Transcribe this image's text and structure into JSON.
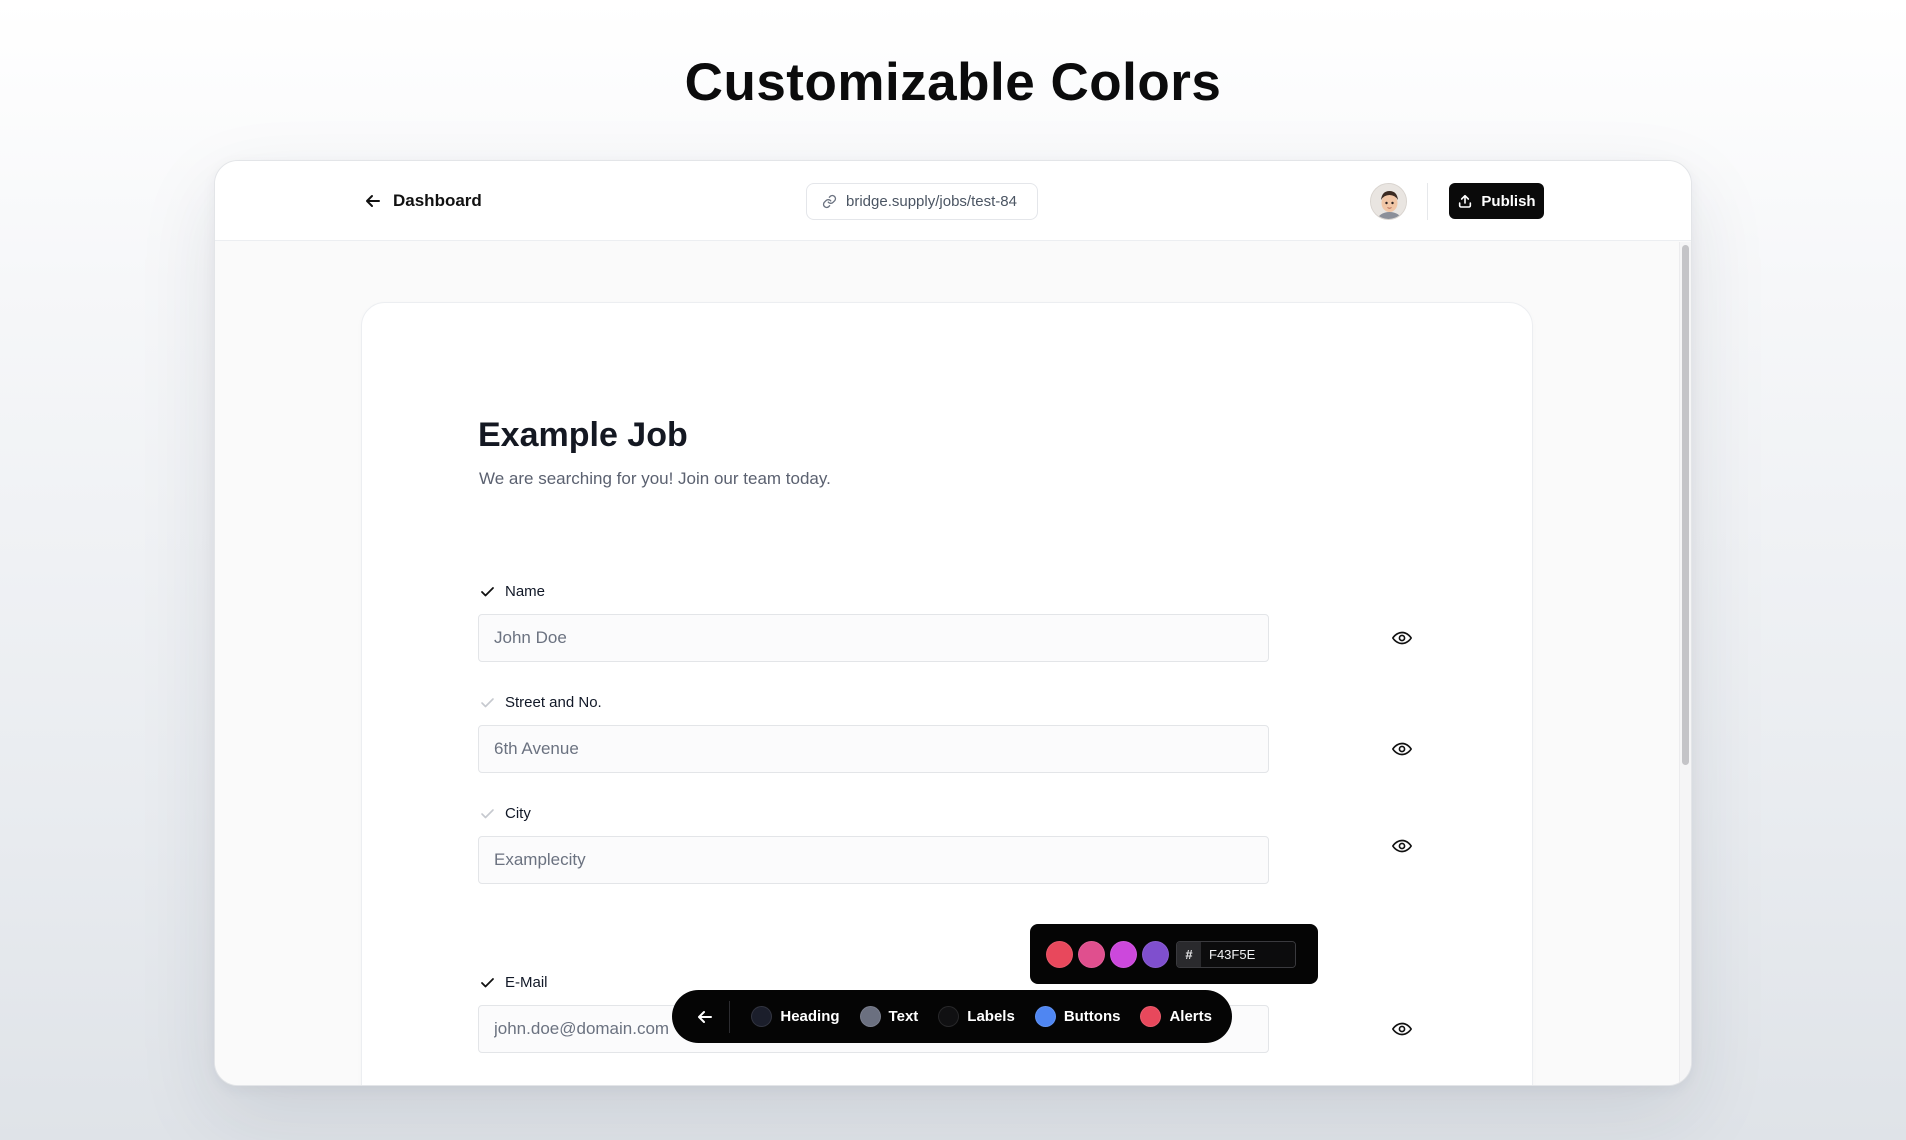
{
  "page": {
    "heading": "Customizable Colors"
  },
  "topbar": {
    "back_label": "Dashboard",
    "url": "bridge.supply/jobs/test-84",
    "publish_label": "Publish"
  },
  "form": {
    "title": "Example Job",
    "subtitle": "We are searching for you! Join our team today.",
    "fields": [
      {
        "label": "Name",
        "placeholder": "John Doe",
        "required": true
      },
      {
        "label": "Street and No.",
        "placeholder": "6th Avenue",
        "required": false
      },
      {
        "label": "City",
        "placeholder": "Examplecity",
        "required": false
      },
      {
        "label": "E-Mail",
        "placeholder": "john.doe@domain.com",
        "required": true
      }
    ]
  },
  "color_picker": {
    "swatches": [
      "#e8485c",
      "#e04f8e",
      "#cc48dc",
      "#7f4fce"
    ],
    "hex_prefix": "#",
    "hex_value": "F43F5E"
  },
  "color_toolbar": {
    "items": [
      {
        "label": "Heading",
        "color": "#1b1e2b"
      },
      {
        "label": "Text",
        "color": "#6b7080"
      },
      {
        "label": "Labels",
        "color": "#101012"
      },
      {
        "label": "Buttons",
        "color": "#4f86f2"
      },
      {
        "label": "Alerts",
        "color": "#e8485c"
      }
    ]
  }
}
